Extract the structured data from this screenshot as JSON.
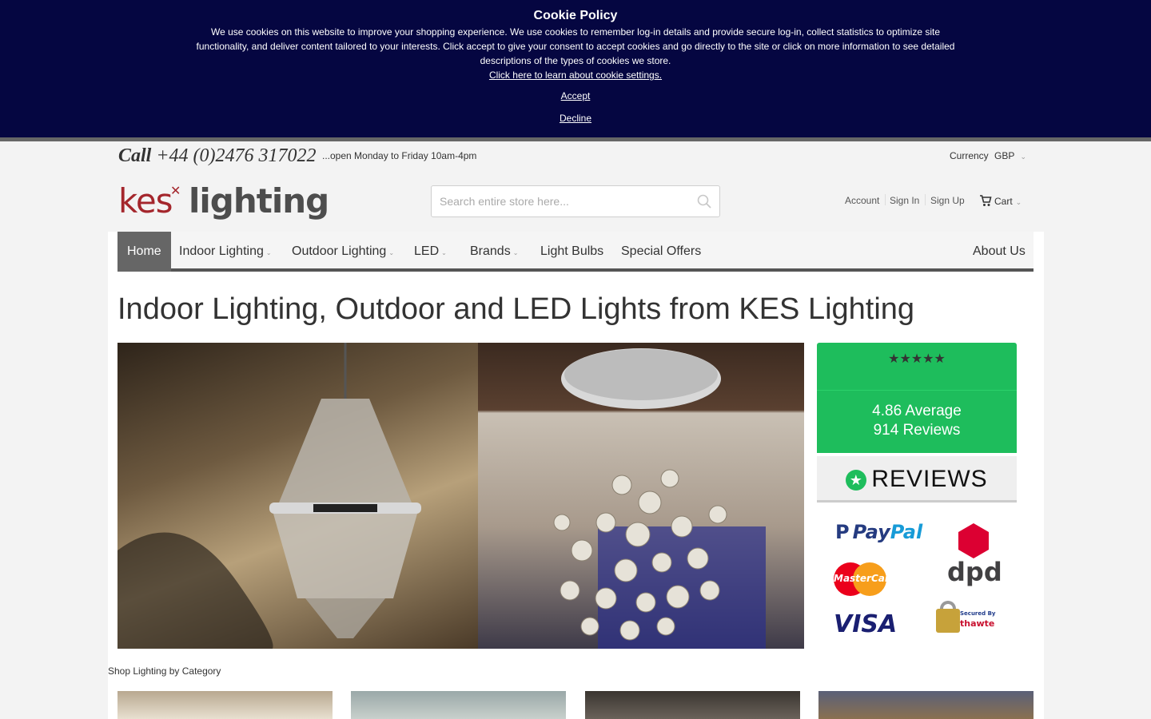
{
  "cookie": {
    "title": "Cookie Policy",
    "message": "We use cookies on this website to improve your shopping experience. We use cookies to remember log-in details and provide secure log-in, collect statistics to optimize site functionality, and deliver content tailored to your interests. Click accept to give your consent to accept cookies and go directly to the site or click on more information to see detailed descriptions of the types of cookies we store.",
    "learn_link": "Click here to learn about cookie settings.",
    "accept": "Accept",
    "decline": "Decline",
    "background": "#050641"
  },
  "header": {
    "call_prefix": "Call",
    "phone": "+44 (0)2476 317022",
    "hours": "...open Monday to Friday 10am-4pm",
    "currency_label": "Currency",
    "currency_value": "GBP",
    "logo_kes": "kes",
    "logo_lighting": "lighting",
    "search_placeholder": "Search entire store here...",
    "account": "Account",
    "sign_in": "Sign In",
    "sign_up": "Sign Up",
    "cart": "Cart"
  },
  "nav": {
    "home": "Home",
    "indoor": "Indoor Lighting",
    "outdoor": "Outdoor Lighting",
    "led": "LED",
    "brands": "Brands",
    "bulbs": "Light Bulbs",
    "offers": "Special Offers",
    "about": "About Us"
  },
  "main": {
    "heading": "Indoor Lighting, Outdoor and LED Lights from KES Lighting",
    "shop_by_category": "Shop Lighting by Category"
  },
  "reviews": {
    "stars": "★★★★★",
    "average": "4.86 Average",
    "count": "914 Reviews",
    "brand": "REVIEWS",
    "rating_value": 4.86,
    "accent": "#1ebd5c"
  },
  "payments": {
    "paypal_a": "Pay",
    "paypal_b": "Pal",
    "dpd": "dpd",
    "mastercard": "MasterCard",
    "visa": "VISA",
    "thawte_secured": "Secured By",
    "thawte": "thawte"
  },
  "colors": {
    "brand_red": "#a4262c",
    "nav_active": "#666666"
  }
}
